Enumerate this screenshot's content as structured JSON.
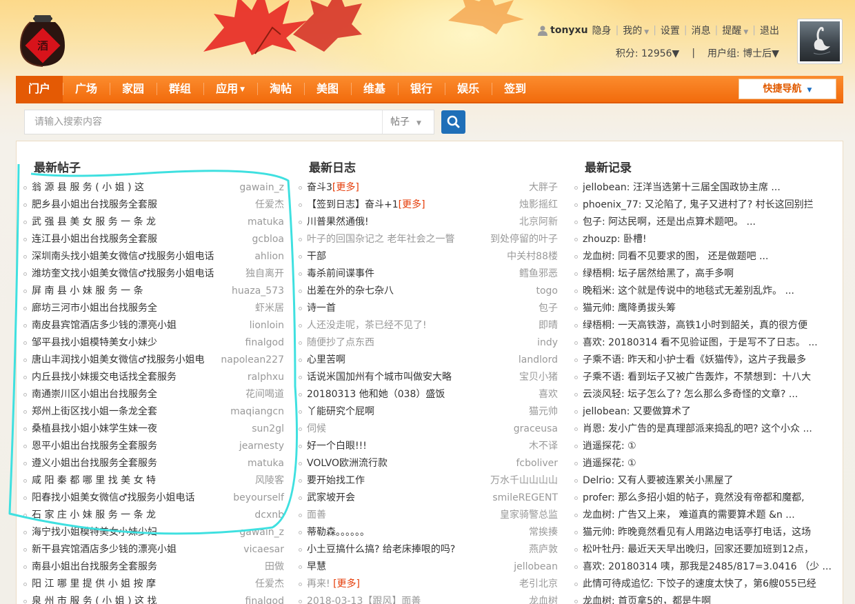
{
  "header": {
    "username": "tonyxu",
    "links_top": [
      "隐身",
      "我的",
      "设置",
      "消息",
      "提醒",
      "退出"
    ],
    "points_label": "积分: 12956",
    "group_label": "用户组: 博士后"
  },
  "nav": {
    "items": [
      "门户",
      "广场",
      "家园",
      "群组",
      "应用",
      "淘帖",
      "美图",
      "维基",
      "银行",
      "娱乐",
      "签到"
    ],
    "active": "门户",
    "quicknav": "快捷导航"
  },
  "search": {
    "placeholder": "请输入搜索内容",
    "type": "帖子"
  },
  "colors": {
    "nav_orange": "#f26b0c",
    "active_tab": "#e45a04",
    "search_button": "#1f6fb8",
    "more_link": "#e53b07",
    "annotation": "#3fe0e0"
  },
  "posts": {
    "title": "最新帖子",
    "items": [
      {
        "title": "翁 源 县 服 务 ( 小 姐 ) 这",
        "author": "gawain_z"
      },
      {
        "title": "肥乡县小姐出台找服务全套服",
        "author": "任爱杰"
      },
      {
        "title": "武 强 县 美 女 服 务 一 条 龙",
        "author": "matuka"
      },
      {
        "title": "连江县小姐出台找服务全套服",
        "author": "gcbloa"
      },
      {
        "title": "深圳南头找小姐美女微信♂找服务小姐电话",
        "author": "ahlion"
      },
      {
        "title": "潍坊奎文找小姐美女微信♂找服务小姐电话",
        "author": "独自离开"
      },
      {
        "title": "屏 南 县 小 妹 服 务 一 条",
        "author": "huaza_573"
      },
      {
        "title": "廊坊三河市小姐出台找服务全",
        "author": "虾米居"
      },
      {
        "title": "南皮县宾馆酒店多少钱的漂亮小姐",
        "author": "lionloin"
      },
      {
        "title": "邹平县找小姐模特美女小妹少",
        "author": "finalgod"
      },
      {
        "title": "唐山丰润找小姐美女微信♂找服务小姐电",
        "author": "napolean227"
      },
      {
        "title": "内丘县找小妹援交电话找全套服务",
        "author": "ralphxu"
      },
      {
        "title": "南通崇川区小姐出台找服务全",
        "author": "花间喝道"
      },
      {
        "title": "郑州上街区找小姐一条龙全套",
        "author": "maqiangcn"
      },
      {
        "title": "桑植县找小姐小妹学生妹一夜",
        "author": "sun2gl"
      },
      {
        "title": "恩平小姐出台找服务全套服务",
        "author": "jearnesty"
      },
      {
        "title": "遵义小姐出台找服务全套服务",
        "author": "matuka"
      },
      {
        "title": "咸 阳 秦 都 哪 里 找 美 女 特",
        "author": "风陵客"
      },
      {
        "title": "阳春找小姐美女微信♂找服务小姐电话",
        "author": "beyourself"
      },
      {
        "title": "石 家 庄 小 妹 服 务 一 条 龙",
        "author": "dcxnb"
      },
      {
        "title": "海宁找小姐模特美女小妹少妇",
        "author": "gawain_z"
      },
      {
        "title": "新干县宾馆酒店多少钱的漂亮小姐",
        "author": "vicaesar"
      },
      {
        "title": "南县小姐出台找服务全套服务",
        "author": "田做"
      },
      {
        "title": "阳 江 哪 里 提 供 小 姐 按 摩",
        "author": "任爱杰"
      },
      {
        "title": "泉 州 市 服 务 ( 小 姐 ) 这 找",
        "author": "finalgod"
      }
    ]
  },
  "blogs": {
    "title": "最新日志",
    "items": [
      {
        "title": "奋斗3",
        "more": "[更多]",
        "author": "大胖子",
        "dim": false
      },
      {
        "title": "【签到日志】奋斗+1",
        "more": "[更多]",
        "author": "烛影摇红",
        "dim": false
      },
      {
        "title": "川普果然通俄!",
        "more": "",
        "author": "北京阿新",
        "dim": false
      },
      {
        "title": "叶子的回国杂记之 老年社会之一瞥",
        "more": "",
        "author": "到处停留的叶子",
        "dim": true
      },
      {
        "title": "干部",
        "more": "",
        "author": "中关村88楼",
        "dim": false
      },
      {
        "title": "毒杀前间谍事件",
        "more": "",
        "author": "鳕鱼邪恶",
        "dim": false
      },
      {
        "title": "出差在外的杂七杂八",
        "more": "",
        "author": "togo",
        "dim": false
      },
      {
        "title": "诗一首",
        "more": "",
        "author": "包子",
        "dim": false
      },
      {
        "title": "人还没走呢，茶已经不见了!",
        "more": "",
        "author": "即晴",
        "dim": true
      },
      {
        "title": "随便抄了点东西",
        "more": "",
        "author": "indy",
        "dim": true
      },
      {
        "title": "心里苦啊",
        "more": "",
        "author": "landlord",
        "dim": false
      },
      {
        "title": "话说米国加州有个城市叫做安大略",
        "more": "",
        "author": "宝贝小猪",
        "dim": false
      },
      {
        "title": "20180313 他和她（038）盛饭",
        "more": "",
        "author": "喜欢",
        "dim": false
      },
      {
        "title": "丫能研究个屁啊",
        "more": "",
        "author": "猫元帅",
        "dim": false
      },
      {
        "title": "伺候",
        "more": "",
        "author": "graceusa",
        "dim": true
      },
      {
        "title": "好一个白眼!!!",
        "more": "",
        "author": "木不译",
        "dim": false
      },
      {
        "title": "VOLVO欧洲流行款",
        "more": "",
        "author": "fcboliver",
        "dim": false
      },
      {
        "title": "要开始找工作",
        "more": "",
        "author": "万水千山山山山",
        "dim": false
      },
      {
        "title": "武家坡开会",
        "more": "",
        "author": "smileREGENT",
        "dim": false
      },
      {
        "title": "面善",
        "more": "",
        "author": "皇家骑警总监",
        "dim": true
      },
      {
        "title": "蒂勒森。。。。。。",
        "more": "",
        "author": "常挨揍",
        "dim": false
      },
      {
        "title": "小土豆搞什么搞? 给老床捧哏的吗?",
        "more": "",
        "author": "燕庐敦",
        "dim": false
      },
      {
        "title": "早慧",
        "more": "",
        "author": "jellobean",
        "dim": false
      },
      {
        "title": "再来! ",
        "more": "[更多]",
        "author": "老引北京",
        "dim": true
      },
      {
        "title": "2018-03-13【跟风】面善",
        "more": "",
        "author": "龙血树",
        "dim": true
      }
    ]
  },
  "records": {
    "title": "最新记录",
    "items": [
      "jellobean: 汪洋当选第十三届全国政协主席 ...",
      "phoenix_77: 又沦陷了, 鬼子又进村了? 村长这回别拦",
      "包子: 阿达民啊，还是出点算术题吧。 ...",
      "zhouzp: 卧槽!",
      "龙血树: 同看不见要求的图， 还是做题吧 ...",
      "绿梧桐: 坛子居然给黑了，高手多啊",
      "晚稻米: 这个就是传说中的地毯式无差别乱炸。 ...",
      "猫元帅: 鹰降勇拔头筹",
      "绿梧桐: 一天高铁游，高铁1小时到韶关，真的很方便",
      "喜欢: 20180314 看不见验证图，于是写不了日志。 ...",
      "子乘不语: 昨天和小护士看《妖猫传》，这片子我最多",
      "子乘不语: 看到坛子又被广告轰炸，不禁想到：十八大",
      "云淡风轻: 坛子怎么了? 怎么那么多奇怪的文章? ...",
      "jellobean: 又要做算术了",
      "肖恩: 发小广告的是真理部派来捣乱的吧? 这个小众 ...",
      "逍遥探花: ①",
      "逍遥探花: ①",
      "Delrio: 又有人要被连累关小黑屋了",
      "profer: 那么多招小姐的帖子，竟然没有帝都和魔都,",
      "龙血树: 广告又上来， 难道真的需要算术题 &n ...",
      "猫元帅: 昨晚竟然看见有人用路边电话亭打电话，这场",
      "松叶牡丹: 最近天天早出晚归，回家还要加班到12点，",
      "喜欢: 20180314 咦，那我是2485/817=3.0416 （少 ...",
      "此情可待成追忆: 下饺子的速度太快了，第6艘055已经",
      "龙血树: 首页拿5的，都是牛啊"
    ]
  }
}
